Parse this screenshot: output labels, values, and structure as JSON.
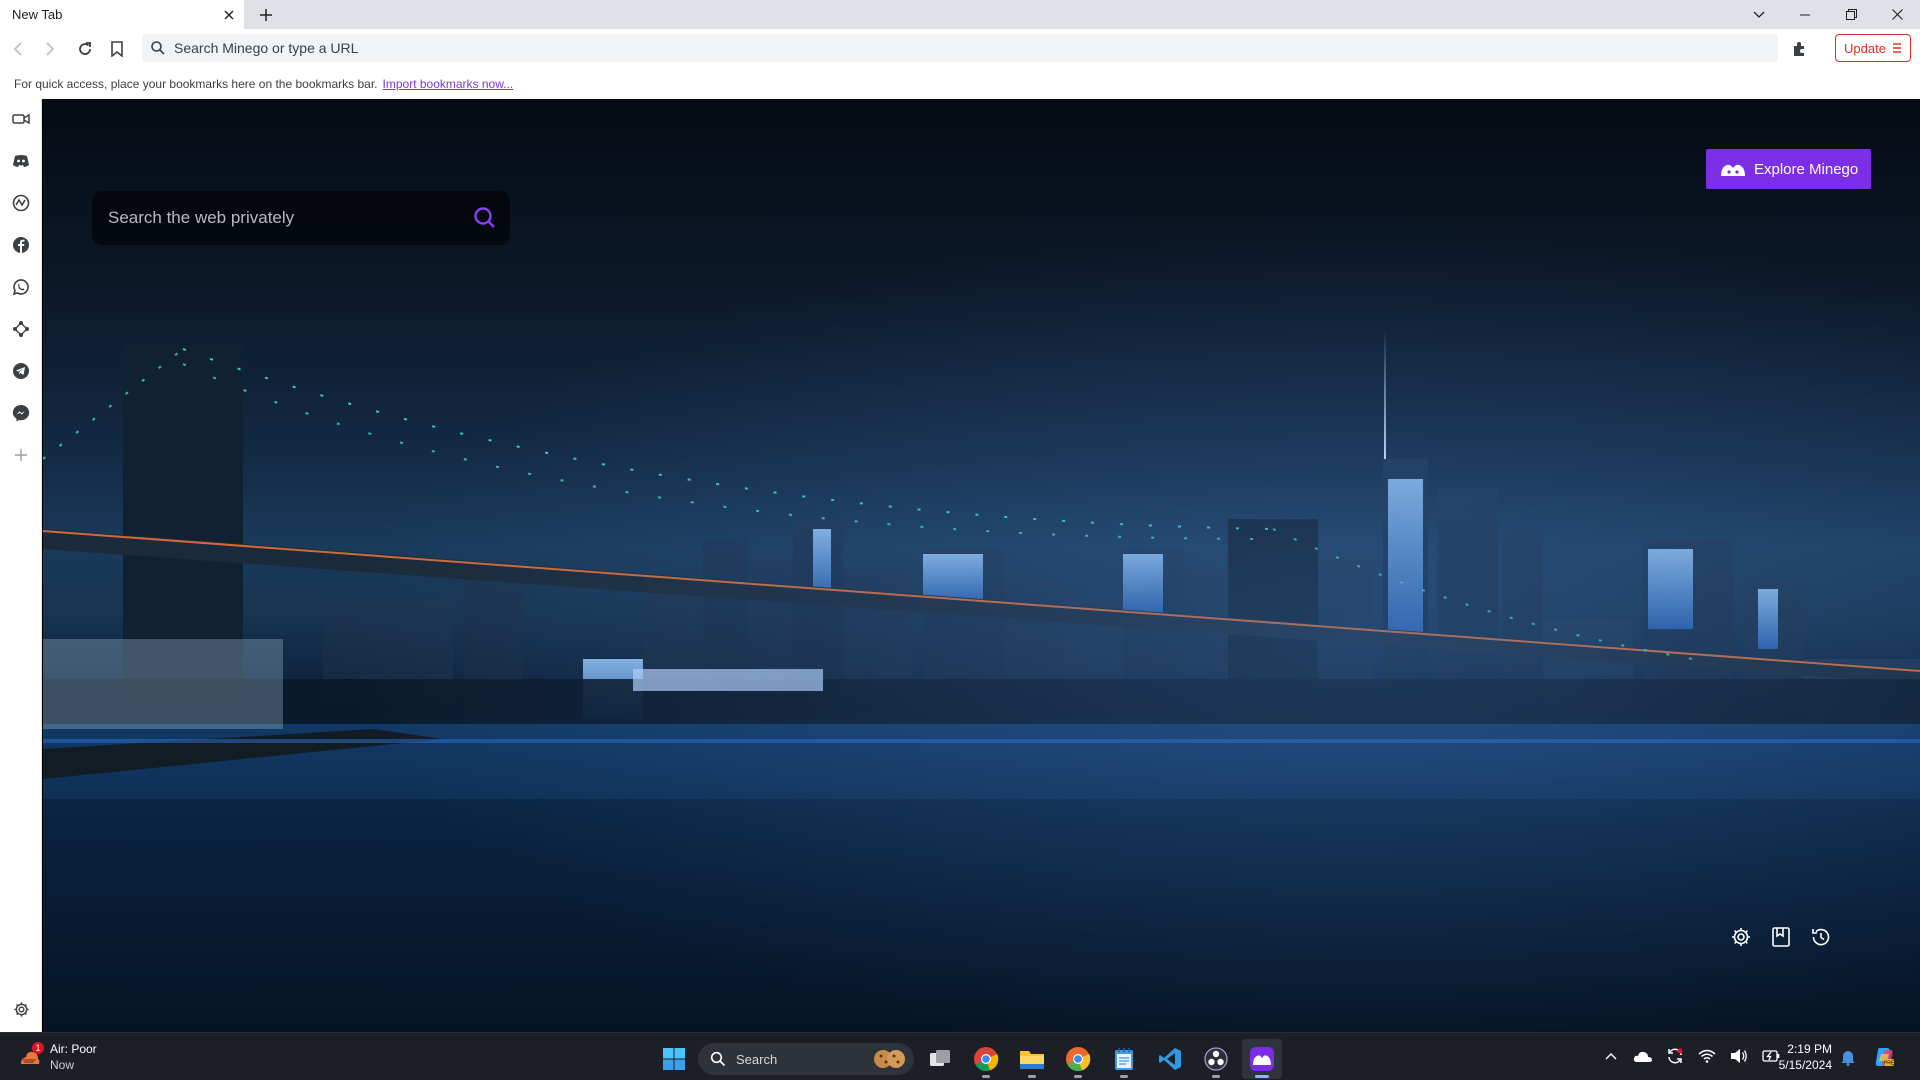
{
  "browser": {
    "tab": {
      "title": "New Tab",
      "close_icon": "close-icon"
    },
    "new_tab_icon": "plus-icon",
    "window_controls": [
      "chevron-down-icon",
      "minimize-icon",
      "restore-icon",
      "close-icon"
    ],
    "omnibox": {
      "placeholder": "Search Minego or type a URL",
      "value": ""
    },
    "update_label": "Update",
    "bookmarks_bar": {
      "message": "For quick access, place your bookmarks here on the bookmarks bar.",
      "link": "Import bookmarks now..."
    }
  },
  "sidebar": {
    "items": [
      {
        "icon": "video-icon"
      },
      {
        "icon": "discord-icon"
      },
      {
        "icon": "activity-icon"
      },
      {
        "icon": "facebook-icon"
      },
      {
        "icon": "whatsapp-icon"
      },
      {
        "icon": "network-icon"
      },
      {
        "icon": "telegram-icon"
      },
      {
        "icon": "messenger-icon"
      },
      {
        "icon": "plus-icon"
      }
    ],
    "settings_icon": "gear-icon"
  },
  "newtab": {
    "search": {
      "placeholder": "Search the web privately",
      "value": ""
    },
    "explore_label": "Explore Minego",
    "accent_color": "#7c2ee6",
    "tools": [
      "gear-icon",
      "bookmark-icon",
      "history-icon"
    ]
  },
  "taskbar": {
    "weather": {
      "badge": "1",
      "title": "Air: Poor",
      "subtitle": "Now"
    },
    "search_placeholder": "Search",
    "apps": [
      "task-view-icon",
      "chrome-icon",
      "file-explorer-icon",
      "chrome-canary-icon",
      "notepad-icon",
      "vscode-icon",
      "obs-icon",
      "minego-icon"
    ],
    "clock": {
      "time": "2:19 PM",
      "date": "5/15/2024"
    }
  }
}
